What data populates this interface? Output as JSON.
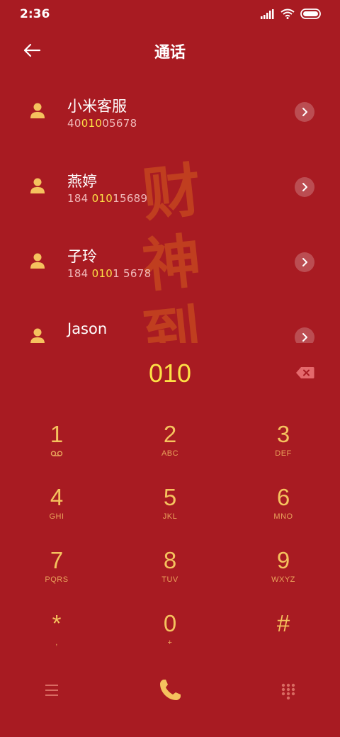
{
  "status_bar": {
    "time": "2:36",
    "icons": [
      "signal-icon",
      "wifi-icon",
      "battery-icon"
    ]
  },
  "header": {
    "title": "通话",
    "back_icon": "arrow-left-icon"
  },
  "contacts": [
    {
      "name": "小米客服",
      "number_parts": [
        [
          "4",
          false
        ],
        [
          "0",
          false
        ],
        [
          "010",
          true
        ],
        [
          "05678",
          false
        ]
      ]
    },
    {
      "name": "燕婷",
      "number_parts": [
        [
          "184 ",
          false
        ],
        [
          "010",
          true
        ],
        [
          "15689",
          false
        ]
      ]
    },
    {
      "name": "子玲",
      "number_parts": [
        [
          "184 ",
          false
        ],
        [
          "010",
          true
        ],
        [
          "1 5678",
          false
        ]
      ]
    },
    {
      "name": "Jason",
      "number_parts": []
    }
  ],
  "watermark": [
    "财",
    "神",
    "到"
  ],
  "dial": {
    "number": "010"
  },
  "keypad": [
    {
      "digit": "1",
      "letters": "",
      "voicemail": true
    },
    {
      "digit": "2",
      "letters": "ABC"
    },
    {
      "digit": "3",
      "letters": "DEF"
    },
    {
      "digit": "4",
      "letters": "GHI"
    },
    {
      "digit": "5",
      "letters": "JKL"
    },
    {
      "digit": "6",
      "letters": "MNO"
    },
    {
      "digit": "7",
      "letters": "PQRS"
    },
    {
      "digit": "8",
      "letters": "TUV"
    },
    {
      "digit": "9",
      "letters": "WXYZ"
    },
    {
      "digit": "*",
      "letters": ","
    },
    {
      "digit": "0",
      "letters": "+"
    },
    {
      "digit": "#",
      "letters": ""
    }
  ],
  "colors": {
    "background": "#a81b22",
    "accent": "#f5c25e",
    "highlight": "#fde046"
  }
}
